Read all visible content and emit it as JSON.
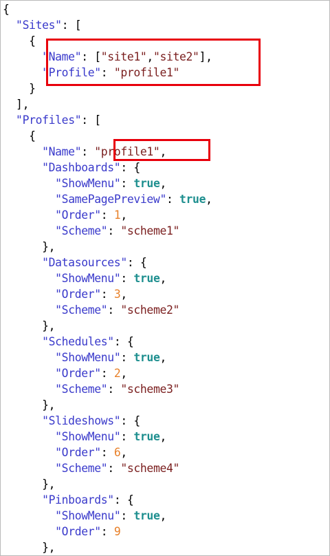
{
  "lines": [
    {
      "indent": 0,
      "segments": [
        {
          "t": "p",
          "v": "{"
        }
      ]
    },
    {
      "indent": 1,
      "segments": [
        {
          "t": "key",
          "v": "\"Sites\""
        },
        {
          "t": "p",
          "v": ": ["
        }
      ]
    },
    {
      "indent": 2,
      "segments": [
        {
          "t": "p",
          "v": "{"
        }
      ]
    },
    {
      "indent": 3,
      "segments": [
        {
          "t": "key",
          "v": "\"Name\""
        },
        {
          "t": "p",
          "v": ": ["
        },
        {
          "t": "str",
          "v": "\"site1\""
        },
        {
          "t": "p",
          "v": ","
        },
        {
          "t": "str",
          "v": "\"site2\""
        },
        {
          "t": "p",
          "v": "],"
        }
      ]
    },
    {
      "indent": 3,
      "segments": [
        {
          "t": "key",
          "v": "\"Profile\""
        },
        {
          "t": "p",
          "v": ": "
        },
        {
          "t": "str",
          "v": "\"profile1\""
        }
      ]
    },
    {
      "indent": 2,
      "segments": [
        {
          "t": "p",
          "v": "}"
        }
      ]
    },
    {
      "indent": 1,
      "segments": [
        {
          "t": "p",
          "v": "],"
        }
      ]
    },
    {
      "indent": 1,
      "segments": [
        {
          "t": "key",
          "v": "\"Profiles\""
        },
        {
          "t": "p",
          "v": ": ["
        }
      ]
    },
    {
      "indent": 2,
      "segments": [
        {
          "t": "p",
          "v": "{"
        }
      ]
    },
    {
      "indent": 3,
      "segments": [
        {
          "t": "key",
          "v": "\"Name\""
        },
        {
          "t": "p",
          "v": ": "
        },
        {
          "t": "str",
          "v": "\"profile1\""
        },
        {
          "t": "p",
          "v": ","
        }
      ]
    },
    {
      "indent": 3,
      "segments": [
        {
          "t": "key",
          "v": "\"Dashboards\""
        },
        {
          "t": "p",
          "v": ": {"
        }
      ]
    },
    {
      "indent": 4,
      "segments": [
        {
          "t": "key",
          "v": "\"ShowMenu\""
        },
        {
          "t": "p",
          "v": ": "
        },
        {
          "t": "bool",
          "v": "true"
        },
        {
          "t": "p",
          "v": ","
        }
      ]
    },
    {
      "indent": 4,
      "segments": [
        {
          "t": "key",
          "v": "\"SamePagePreview\""
        },
        {
          "t": "p",
          "v": ": "
        },
        {
          "t": "bool",
          "v": "true"
        },
        {
          "t": "p",
          "v": ","
        }
      ]
    },
    {
      "indent": 4,
      "segments": [
        {
          "t": "key",
          "v": "\"Order\""
        },
        {
          "t": "p",
          "v": ": "
        },
        {
          "t": "num",
          "v": "1"
        },
        {
          "t": "p",
          "v": ","
        }
      ]
    },
    {
      "indent": 4,
      "segments": [
        {
          "t": "key",
          "v": "\"Scheme\""
        },
        {
          "t": "p",
          "v": ": "
        },
        {
          "t": "str",
          "v": "\"scheme1\""
        }
      ]
    },
    {
      "indent": 3,
      "segments": [
        {
          "t": "p",
          "v": "},"
        }
      ]
    },
    {
      "indent": 3,
      "segments": [
        {
          "t": "key",
          "v": "\"Datasources\""
        },
        {
          "t": "p",
          "v": ": {"
        }
      ]
    },
    {
      "indent": 4,
      "segments": [
        {
          "t": "key",
          "v": "\"ShowMenu\""
        },
        {
          "t": "p",
          "v": ": "
        },
        {
          "t": "bool",
          "v": "true"
        },
        {
          "t": "p",
          "v": ","
        }
      ]
    },
    {
      "indent": 4,
      "segments": [
        {
          "t": "key",
          "v": "\"Order\""
        },
        {
          "t": "p",
          "v": ": "
        },
        {
          "t": "num",
          "v": "3"
        },
        {
          "t": "p",
          "v": ","
        }
      ]
    },
    {
      "indent": 4,
      "segments": [
        {
          "t": "key",
          "v": "\"Scheme\""
        },
        {
          "t": "p",
          "v": ": "
        },
        {
          "t": "str",
          "v": "\"scheme2\""
        }
      ]
    },
    {
      "indent": 3,
      "segments": [
        {
          "t": "p",
          "v": "},"
        }
      ]
    },
    {
      "indent": 3,
      "segments": [
        {
          "t": "key",
          "v": "\"Schedules\""
        },
        {
          "t": "p",
          "v": ": {"
        }
      ]
    },
    {
      "indent": 4,
      "segments": [
        {
          "t": "key",
          "v": "\"ShowMenu\""
        },
        {
          "t": "p",
          "v": ": "
        },
        {
          "t": "bool",
          "v": "true"
        },
        {
          "t": "p",
          "v": ","
        }
      ]
    },
    {
      "indent": 4,
      "segments": [
        {
          "t": "key",
          "v": "\"Order\""
        },
        {
          "t": "p",
          "v": ": "
        },
        {
          "t": "num",
          "v": "2"
        },
        {
          "t": "p",
          "v": ","
        }
      ]
    },
    {
      "indent": 4,
      "segments": [
        {
          "t": "key",
          "v": "\"Scheme\""
        },
        {
          "t": "p",
          "v": ": "
        },
        {
          "t": "str",
          "v": "\"scheme3\""
        }
      ]
    },
    {
      "indent": 3,
      "segments": [
        {
          "t": "p",
          "v": "},"
        }
      ]
    },
    {
      "indent": 3,
      "segments": [
        {
          "t": "key",
          "v": "\"Slideshows\""
        },
        {
          "t": "p",
          "v": ": {"
        }
      ]
    },
    {
      "indent": 4,
      "segments": [
        {
          "t": "key",
          "v": "\"ShowMenu\""
        },
        {
          "t": "p",
          "v": ": "
        },
        {
          "t": "bool",
          "v": "true"
        },
        {
          "t": "p",
          "v": ","
        }
      ]
    },
    {
      "indent": 4,
      "segments": [
        {
          "t": "key",
          "v": "\"Order\""
        },
        {
          "t": "p",
          "v": ": "
        },
        {
          "t": "num",
          "v": "6"
        },
        {
          "t": "p",
          "v": ","
        }
      ]
    },
    {
      "indent": 4,
      "segments": [
        {
          "t": "key",
          "v": "\"Scheme\""
        },
        {
          "t": "p",
          "v": ": "
        },
        {
          "t": "str",
          "v": "\"scheme4\""
        }
      ]
    },
    {
      "indent": 3,
      "segments": [
        {
          "t": "p",
          "v": "},"
        }
      ]
    },
    {
      "indent": 3,
      "segments": [
        {
          "t": "key",
          "v": "\"Pinboards\""
        },
        {
          "t": "p",
          "v": ": {"
        }
      ]
    },
    {
      "indent": 4,
      "segments": [
        {
          "t": "key",
          "v": "\"ShowMenu\""
        },
        {
          "t": "p",
          "v": ": "
        },
        {
          "t": "bool",
          "v": "true"
        },
        {
          "t": "p",
          "v": ","
        }
      ]
    },
    {
      "indent": 4,
      "segments": [
        {
          "t": "key",
          "v": "\"Order\""
        },
        {
          "t": "p",
          "v": ": "
        },
        {
          "t": "num",
          "v": "9"
        }
      ]
    },
    {
      "indent": 3,
      "segments": [
        {
          "t": "p",
          "v": "},"
        }
      ]
    }
  ],
  "colors": {
    "key": "#3a3acb",
    "string": "#7a1e1e",
    "boolean": "#1e8f8f",
    "number": "#e8812a",
    "highlight": "#e8000b"
  }
}
